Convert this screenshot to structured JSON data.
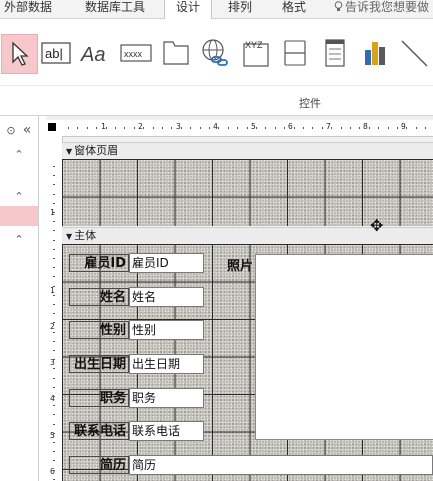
{
  "ribbon": {
    "tabs": [
      {
        "label": "外部数据",
        "active": false
      },
      {
        "label": "数据库工具",
        "active": false
      },
      {
        "label": "设计",
        "active": true
      },
      {
        "label": "排列",
        "active": false
      },
      {
        "label": "格式",
        "active": false
      }
    ],
    "tell_me": "告诉我您想要做",
    "group_label": "控件",
    "tools": [
      {
        "icon": "select-pointer-icon",
        "selected": true
      },
      {
        "icon": "textbox-icon",
        "text": "ab|"
      },
      {
        "icon": "label-icon",
        "text": "Aa"
      },
      {
        "icon": "button-icon",
        "text": "xxxx"
      },
      {
        "icon": "tab-control-icon"
      },
      {
        "icon": "hyperlink-icon"
      },
      {
        "icon": "web-browser-icon",
        "text": "XYZ"
      },
      {
        "icon": "navigation-control-icon"
      },
      {
        "icon": "option-group-icon"
      },
      {
        "icon": "chart-icon"
      },
      {
        "icon": "line-icon"
      }
    ]
  },
  "nav": {
    "items": [
      "⊙",
      "«",
      "⌃",
      "⌃",
      "⌃"
    ]
  },
  "ruler": {
    "h_numbers": [
      "1",
      "2",
      "3",
      "4",
      "5",
      "6",
      "7",
      "8",
      "9"
    ],
    "v_numbers": [
      "1",
      "1",
      "2",
      "3",
      "4",
      "5",
      "6"
    ]
  },
  "form": {
    "header_section": "窗体页眉",
    "detail_section": "主体",
    "photo_label": "照片",
    "fields": [
      {
        "label": "雇员ID",
        "value": "雇员ID"
      },
      {
        "label": "姓名",
        "value": "姓名"
      },
      {
        "label": "性别",
        "value": "性别"
      },
      {
        "label": "出生日期",
        "value": "出生日期"
      },
      {
        "label": "职务",
        "value": "职务"
      },
      {
        "label": "联系电话",
        "value": "联系电话"
      },
      {
        "label": "简历",
        "value": "简历"
      }
    ]
  },
  "colors": {
    "selected_tool": "#f6c8cc",
    "grid_bg": "#bdbab4",
    "chart_icon_blue": "#2e6db4",
    "chart_icon_gold": "#d9a21b"
  }
}
